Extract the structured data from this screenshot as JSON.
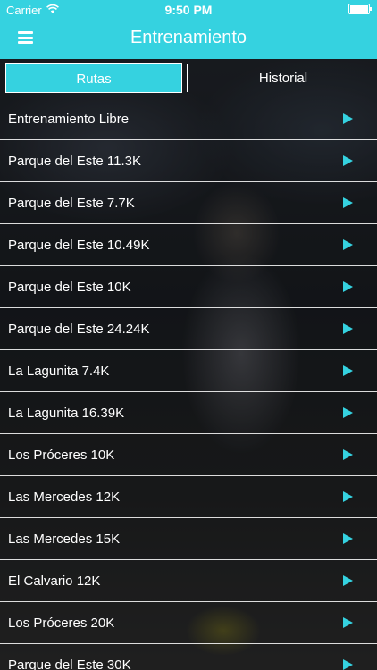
{
  "status": {
    "carrier": "Carrier",
    "time": "9:50 PM"
  },
  "header": {
    "title": "Entrenamiento"
  },
  "tabs": [
    {
      "label": "Rutas",
      "active": true
    },
    {
      "label": "Historial",
      "active": false
    }
  ],
  "routes": [
    "Entrenamiento Libre",
    "Parque del Este 11.3K",
    "Parque del Este 7.7K",
    "Parque del Este 10.49K",
    "Parque del Este 10K",
    "Parque del Este 24.24K",
    "La Lagunita 7.4K",
    "La Lagunita 16.39K",
    "Los Próceres 10K",
    "Las Mercedes 12K",
    "Las Mercedes 15K",
    "El Calvario 12K",
    "Los Próceres 20K",
    "Parque del Este 30K"
  ],
  "colors": {
    "accent": "#35d2e0",
    "text": "#ffffff"
  }
}
